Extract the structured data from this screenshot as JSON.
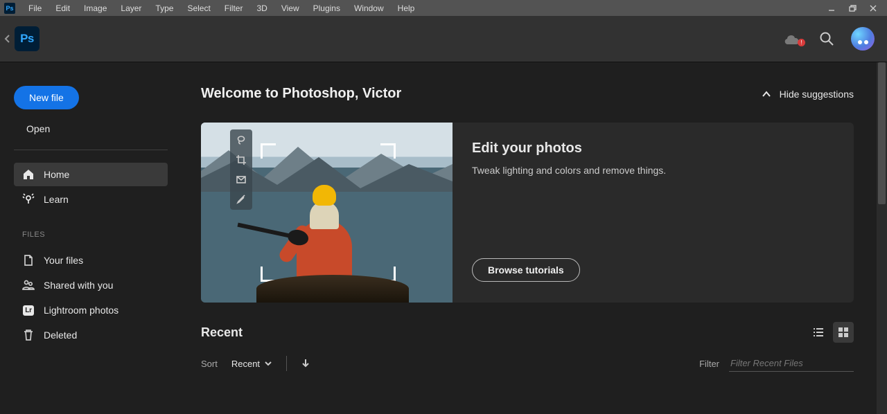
{
  "menubar": {
    "items": [
      "File",
      "Edit",
      "Image",
      "Layer",
      "Type",
      "Select",
      "Filter",
      "3D",
      "View",
      "Plugins",
      "Window",
      "Help"
    ]
  },
  "app_logo_text": "Ps",
  "cloud_badge": "!",
  "sidebar": {
    "new_file": "New file",
    "open": "Open",
    "nav": {
      "home": "Home",
      "learn": "Learn"
    },
    "files_label": "FILES",
    "files": {
      "your_files": "Your files",
      "shared": "Shared with you",
      "lightroom": "Lightroom photos",
      "lightroom_badge": "Lr",
      "deleted": "Deleted"
    }
  },
  "main": {
    "welcome": "Welcome to Photoshop, Victor",
    "hide_suggestions": "Hide suggestions",
    "card": {
      "title": "Edit your photos",
      "subtitle": "Tweak lighting and colors and remove things.",
      "button": "Browse tutorials"
    },
    "recent": "Recent",
    "sort_label": "Sort",
    "sort_value": "Recent",
    "filter_label": "Filter",
    "filter_placeholder": "Filter Recent Files"
  }
}
